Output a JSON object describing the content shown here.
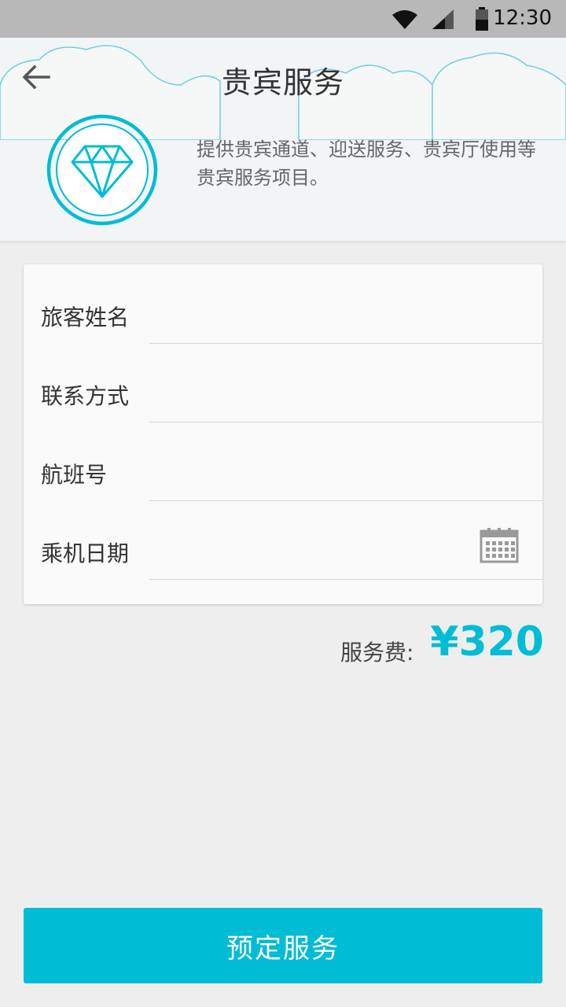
{
  "status_bar": {
    "time": "12:30",
    "icons": [
      "wifi-icon",
      "signal-icon",
      "battery-icon"
    ]
  },
  "header": {
    "title": "贵宾服务",
    "back_icon": "arrow-left-icon",
    "badge_icon": "diamond-icon",
    "description": "提供贵宾通道、迎送服务、贵宾厅使用等贵宾服务项目。"
  },
  "form": {
    "fields": [
      {
        "label": "旅客姓名",
        "value": ""
      },
      {
        "label": "联系方式",
        "value": ""
      },
      {
        "label": "航班号",
        "value": ""
      },
      {
        "label": "乘机日期",
        "value": "",
        "icon": "calendar-icon"
      }
    ]
  },
  "fee": {
    "label": "服务费:",
    "amount": "¥320"
  },
  "actions": {
    "book_label": "预定服务"
  },
  "colors": {
    "accent": "#00bcd4",
    "header_bg": "#f1f5f6",
    "page_bg": "#eeeeee",
    "status_bar_bg": "#b8b8b8"
  }
}
